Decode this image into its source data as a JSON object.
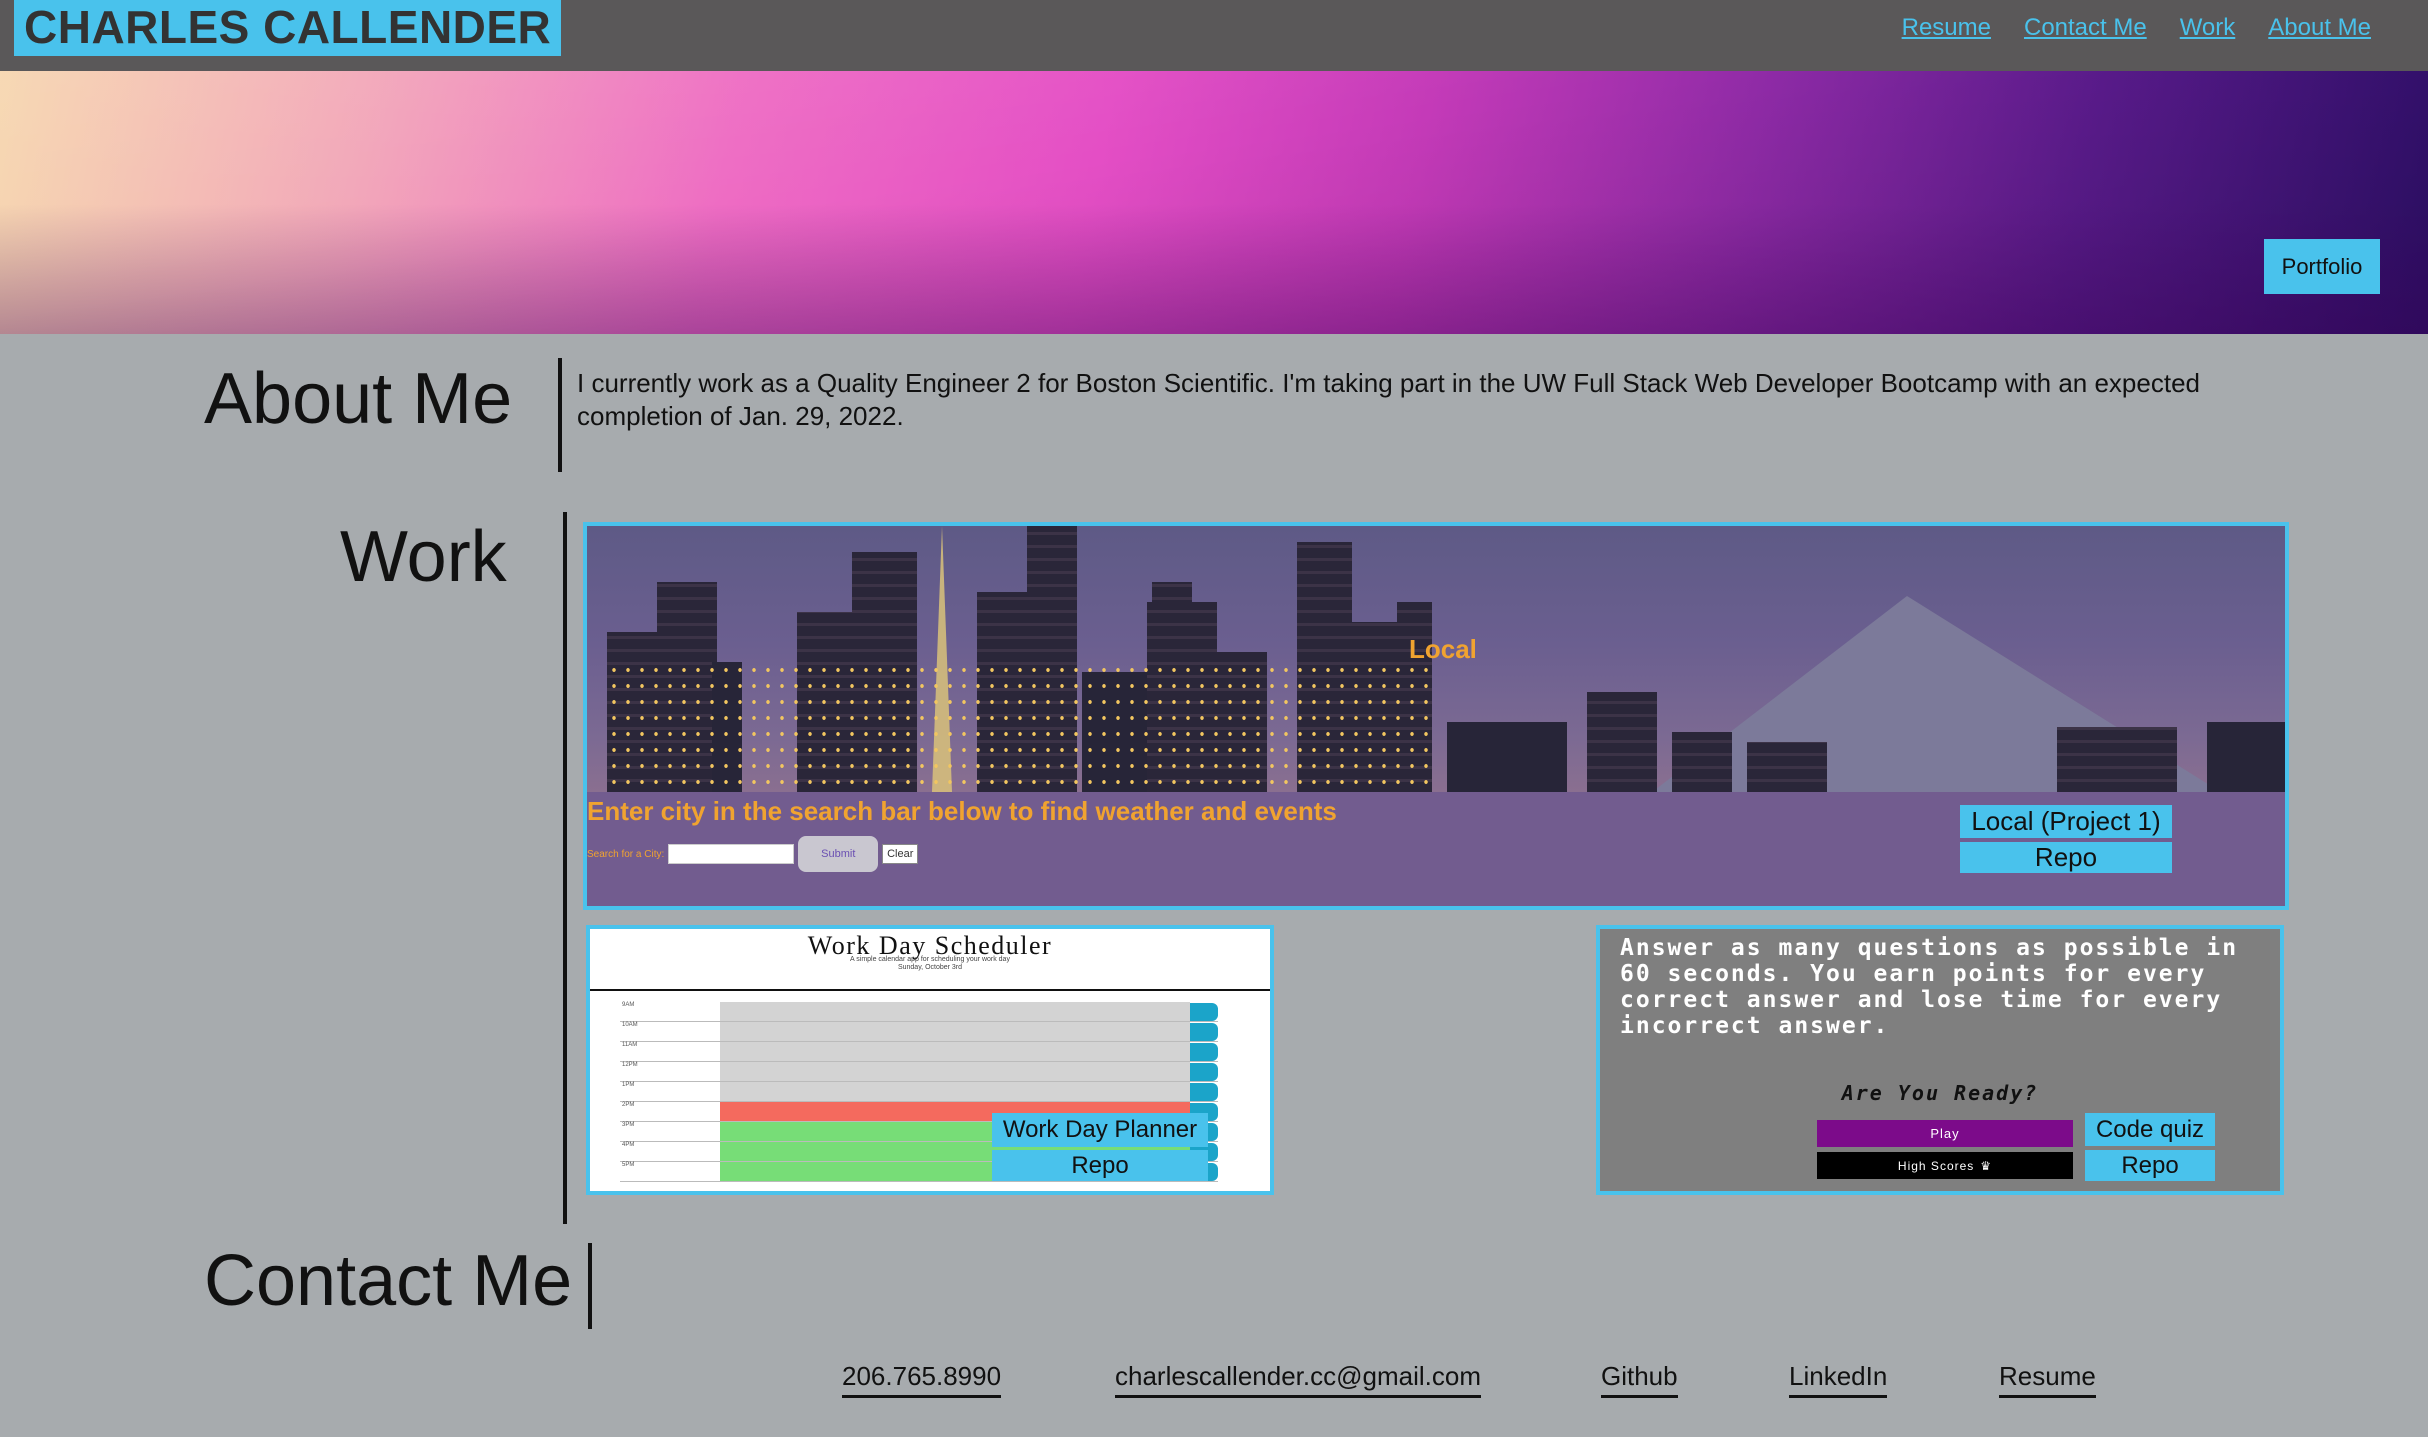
{
  "header": {
    "logo": "CHARLES CALLENDER",
    "nav": [
      "Resume",
      "Contact Me",
      "Work",
      "About Me"
    ]
  },
  "hero": {
    "button_label": "Portfolio"
  },
  "about": {
    "title": "About Me",
    "text": "I currently work as a Quality Engineer 2 for Boston Scientific. I'm taking part in the UW Full Stack Web Developer Bootcamp with an expected completion of Jan. 29, 2022."
  },
  "work": {
    "title": "Work",
    "weather": {
      "local_label": "Local",
      "prompt": "Enter city in the search bar below to find weather and events",
      "search_label": "Search for a City:",
      "submit": "Submit",
      "clear": "Clear",
      "project_link": "Local (Project 1)",
      "repo_link": "Repo"
    },
    "scheduler": {
      "title": "Work Day Scheduler",
      "subtitle_1": "A simple calendar app for scheduling your work day",
      "subtitle_2": "Sunday, October 3rd",
      "hours": [
        "9AM",
        "10AM",
        "11AM",
        "12PM",
        "1PM",
        "2PM",
        "3PM",
        "4PM",
        "5PM"
      ],
      "project_link": "Work Day Planner",
      "repo_link": "Repo"
    },
    "quiz": {
      "text": "Answer as many questions as possible in 60 seconds. You earn points for every correct answer and lose time for every incorrect answer.",
      "ready": "Are You Ready?",
      "play": "Play",
      "high_scores": "High Scores",
      "project_link": "Code quiz",
      "repo_link": "Repo"
    }
  },
  "contact": {
    "title": "Contact Me",
    "links": [
      "206.765.8990",
      "charlescallender.cc@gmail.com",
      "Github",
      "LinkedIn",
      "Resume"
    ]
  },
  "colors": {
    "accent": "#49c2ec",
    "header_bg": "#5a5859",
    "page_bg": "#a7abae",
    "weather_bg": "#725c8f",
    "weather_text": "#f0a330"
  }
}
